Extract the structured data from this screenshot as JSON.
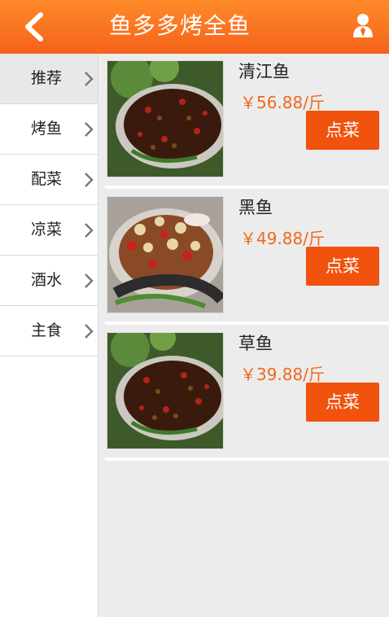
{
  "header": {
    "title": "鱼多多烤全鱼",
    "back_icon": "chevron-left-icon",
    "user_icon": "user-icon"
  },
  "categories": [
    {
      "label": "推荐",
      "active": true
    },
    {
      "label": "烤鱼",
      "active": false
    },
    {
      "label": "配菜",
      "active": false
    },
    {
      "label": "凉菜",
      "active": false
    },
    {
      "label": "酒水",
      "active": false
    },
    {
      "label": "主食",
      "active": false
    }
  ],
  "items": [
    {
      "name": "清江鱼",
      "price": "￥56.88/斤",
      "button": "点菜"
    },
    {
      "name": "黑鱼",
      "price": "￥49.88/斤",
      "button": "点菜"
    },
    {
      "name": "草鱼",
      "price": "￥39.88/斤",
      "button": "点菜"
    }
  ],
  "colors": {
    "header_top": "#ff8a2a",
    "header_bottom": "#f4621a",
    "price": "#ef6a1c",
    "button": "#f1530f"
  }
}
